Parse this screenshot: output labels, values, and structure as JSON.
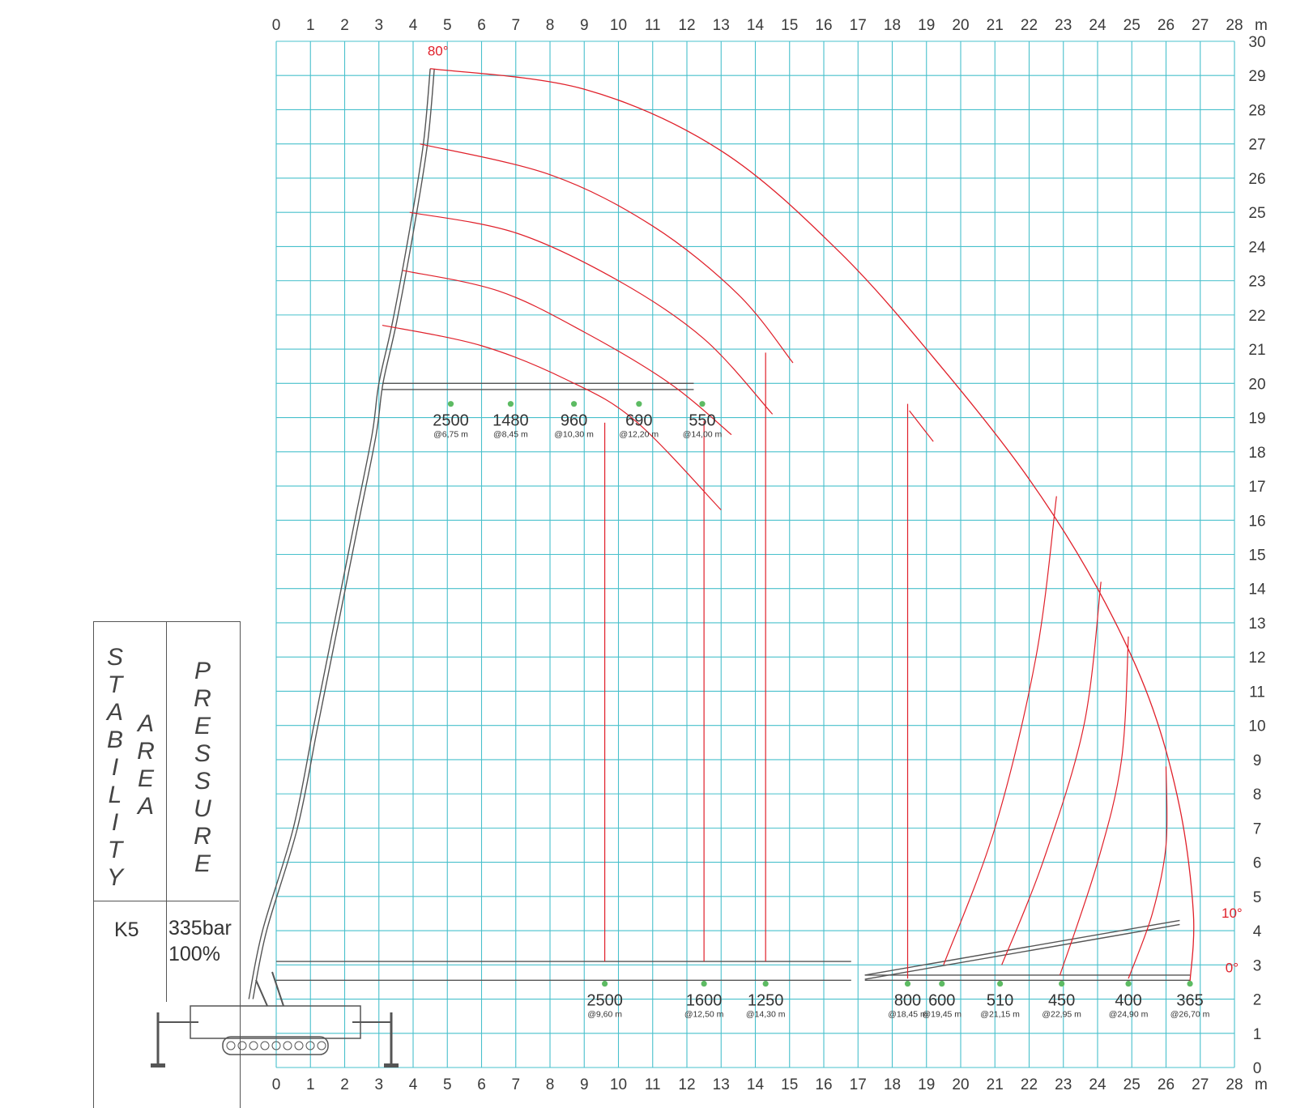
{
  "chart_data": {
    "type": "line",
    "x_axis": {
      "min": 0,
      "max": 28,
      "unit": "m",
      "ticks": [
        0,
        1,
        2,
        3,
        4,
        5,
        6,
        7,
        8,
        9,
        10,
        11,
        12,
        13,
        14,
        15,
        16,
        17,
        18,
        19,
        20,
        21,
        22,
        23,
        24,
        25,
        26,
        27,
        28
      ]
    },
    "y_axis": {
      "min": 0,
      "max": 30,
      "ticks": [
        0,
        1,
        2,
        3,
        4,
        5,
        6,
        7,
        8,
        9,
        10,
        11,
        12,
        13,
        14,
        15,
        16,
        17,
        18,
        19,
        20,
        21,
        22,
        23,
        24,
        25,
        26,
        27,
        28,
        29,
        30
      ]
    },
    "grid": true,
    "angle_labels": [
      {
        "text": "80°",
        "x": 4.3,
        "y": 29.3
      },
      {
        "text": "10°",
        "x": 27.5,
        "y": 4.1
      },
      {
        "text": "0°",
        "x": 27.5,
        "y": 2.5
      }
    ],
    "outer_envelope": {
      "points": [
        [
          4.5,
          29.2
        ],
        [
          9,
          28.6
        ],
        [
          13,
          26.8
        ],
        [
          16.5,
          23.8
        ],
        [
          19.5,
          20.4
        ],
        [
          22,
          17.2
        ],
        [
          24,
          14.0
        ],
        [
          25.5,
          10.8
        ],
        [
          26.4,
          7.6
        ],
        [
          26.8,
          4.5
        ],
        [
          26.7,
          2.5
        ]
      ]
    },
    "jib_arcs": [
      {
        "points": [
          [
            4.2,
            27.0
          ],
          [
            8,
            26.1
          ],
          [
            11,
            24.6
          ],
          [
            13.5,
            22.6
          ],
          [
            15.1,
            20.6
          ]
        ]
      },
      {
        "points": [
          [
            3.9,
            25.0
          ],
          [
            7,
            24.4
          ],
          [
            10,
            23.0
          ],
          [
            12.5,
            21.3
          ],
          [
            14.5,
            19.1
          ]
        ]
      },
      {
        "points": [
          [
            3.7,
            23.3
          ],
          [
            6.5,
            22.7
          ],
          [
            9,
            21.5
          ],
          [
            11.5,
            20.0
          ],
          [
            13.3,
            18.5
          ]
        ]
      },
      {
        "points": [
          [
            3.1,
            21.7
          ],
          [
            6,
            21.1
          ],
          [
            8.5,
            20.1
          ],
          [
            10.5,
            18.9
          ],
          [
            13.0,
            16.3
          ]
        ]
      }
    ],
    "outer_arcs": [
      {
        "points": [
          [
            18.5,
            19.2
          ],
          [
            19.2,
            18.3
          ]
        ]
      },
      {
        "points": [
          [
            22.8,
            16.7
          ],
          [
            22.2,
            12
          ],
          [
            21,
            7
          ],
          [
            19.5,
            3.0
          ]
        ]
      },
      {
        "points": [
          [
            24.1,
            14.2
          ],
          [
            23.6,
            10
          ],
          [
            22.4,
            6
          ],
          [
            21.2,
            3.0
          ]
        ]
      },
      {
        "points": [
          [
            24.9,
            12.6
          ],
          [
            24.7,
            9
          ],
          [
            24,
            6
          ],
          [
            22.9,
            2.7
          ]
        ]
      },
      {
        "points": [
          [
            26.0,
            8.8
          ],
          [
            26.0,
            6.5
          ],
          [
            25.6,
            4.5
          ],
          [
            24.9,
            2.6
          ]
        ]
      }
    ],
    "verticals": [
      {
        "x": 9.6,
        "y_top": 18.85,
        "y_bottom": 3.1
      },
      {
        "x": 12.5,
        "y_top": 18.9,
        "y_bottom": 3.1
      },
      {
        "x": 14.3,
        "y_top": 20.9,
        "y_bottom": 3.1
      },
      {
        "x": 18.45,
        "y_top": 19.4,
        "y_bottom": 2.6
      }
    ],
    "boom_ladder": {
      "points": [
        [
          -0.8,
          2.0
        ],
        [
          -0.4,
          4.0
        ],
        [
          0.5,
          7.0
        ],
        [
          1.1,
          10.0
        ],
        [
          1.7,
          13.0
        ],
        [
          2.3,
          16.0
        ],
        [
          2.8,
          18.5
        ],
        [
          3.0,
          20.0
        ],
        [
          3.4,
          21.8
        ],
        [
          3.9,
          24.5
        ],
        [
          4.3,
          27.0
        ],
        [
          4.5,
          29.2
        ]
      ]
    },
    "boom_jib_high": {
      "points": [
        [
          3.1,
          20.0
        ],
        [
          12.2,
          20.0
        ]
      ]
    },
    "boom_horizontal": {
      "points": [
        [
          0.0,
          3.1
        ],
        [
          16.8,
          3.1
        ]
      ]
    },
    "boom_0deg": {
      "points": [
        [
          17.2,
          2.7
        ],
        [
          26.7,
          2.7
        ]
      ]
    },
    "boom_10deg": {
      "points": [
        [
          17.2,
          2.7
        ],
        [
          26.4,
          4.3
        ]
      ]
    },
    "loads_upper": [
      {
        "value": "2500",
        "at": "@6,75 m",
        "x": 5.1
      },
      {
        "value": "1480",
        "at": "@8,45 m",
        "x": 6.85
      },
      {
        "value": "960",
        "at": "@10,30 m",
        "x": 8.7
      },
      {
        "value": "690",
        "at": "@12,20 m",
        "x": 10.6
      },
      {
        "value": "550",
        "at": "@14,00 m",
        "x": 12.45
      }
    ],
    "loads_upper_y": 19.4,
    "loads_lower": [
      {
        "value": "2500",
        "at": "@9,60 m",
        "x": 9.6
      },
      {
        "value": "1600",
        "at": "@12,50 m",
        "x": 12.5
      },
      {
        "value": "1250",
        "at": "@14,30 m",
        "x": 14.3
      },
      {
        "value": "800",
        "at": "@18,45 m",
        "x": 18.45
      },
      {
        "value": "600",
        "at": "@19,45 m",
        "x": 19.45
      },
      {
        "value": "510",
        "at": "@21,15 m",
        "x": 21.15
      },
      {
        "value": "450",
        "at": "@22,95 m",
        "x": 22.95
      },
      {
        "value": "400",
        "at": "@24,90 m",
        "x": 24.9
      },
      {
        "value": "365",
        "at": "@26,70 m",
        "x": 26.7
      }
    ],
    "loads_lower_y": 2.45
  },
  "panel": {
    "stability": "STABILITY",
    "area": "AREA",
    "pressure": "PRESSURE",
    "model": "K5",
    "bar": "335bar",
    "percent": "100%"
  },
  "colors": {
    "grid": "#48c0cc",
    "curve": "#e0202a",
    "point": "#5dbb63",
    "boom": "#555555"
  }
}
